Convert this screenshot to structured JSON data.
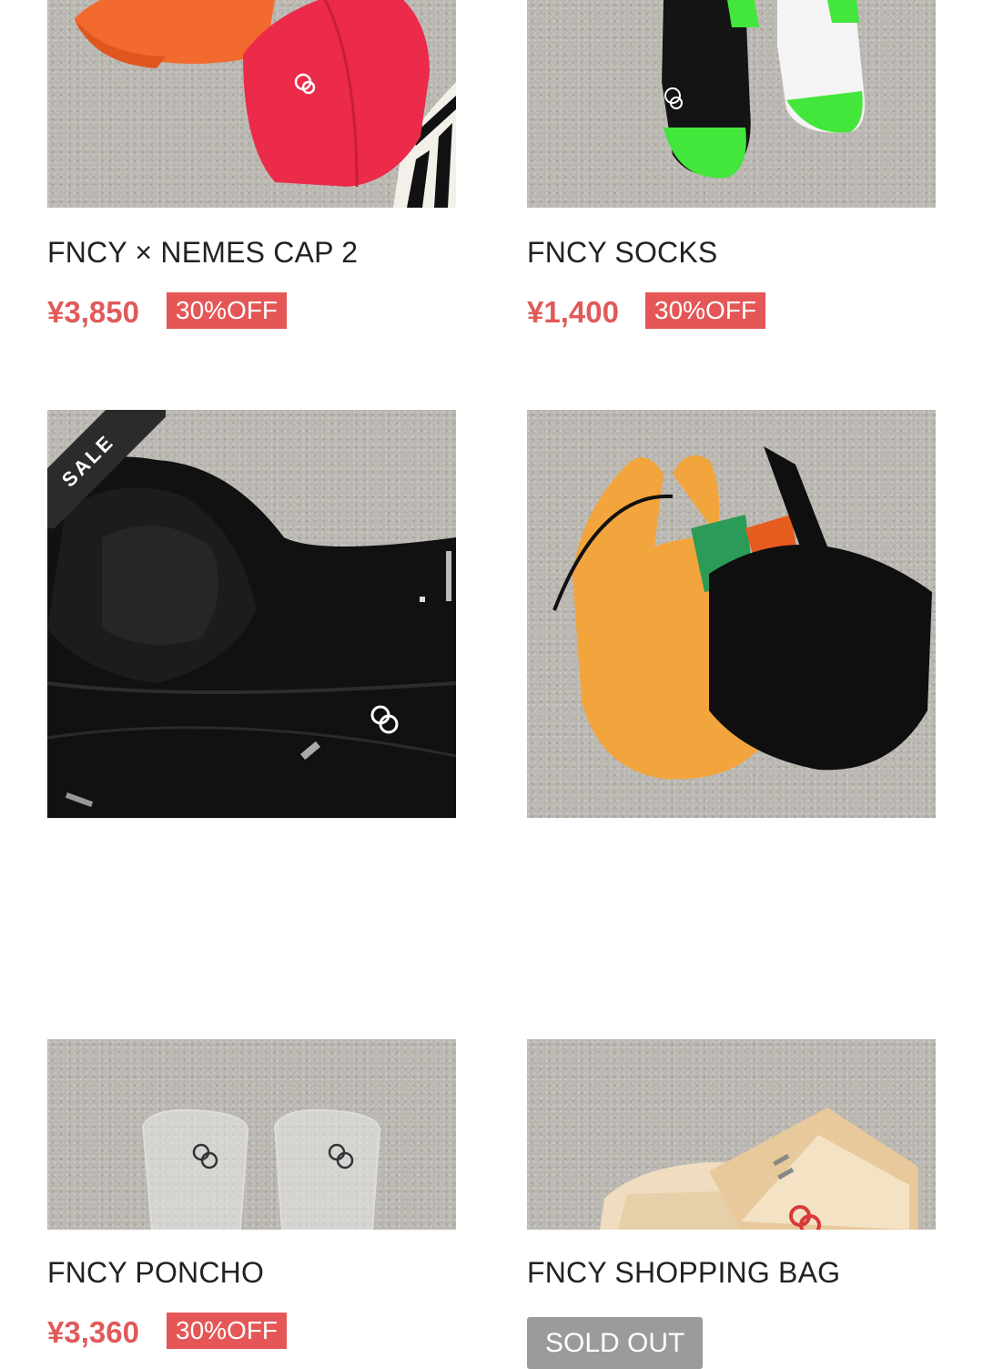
{
  "products": [
    {
      "name": "FNCY × NEMES CAP 2",
      "price": "¥3,850",
      "discount": "30%OFF"
    },
    {
      "name": "FNCY SOCKS",
      "price": "¥1,400",
      "discount": "30%OFF"
    },
    {
      "name": "FNCY PONCHO",
      "price": "¥3,360",
      "discount": "30%OFF",
      "ribbon": "SALE"
    },
    {
      "name": "FNCY SHOPPING BAG",
      "status": "SOLD OUT"
    }
  ],
  "colors": {
    "price": "#e05a5a",
    "discount_badge": "#e55656",
    "sold_out_badge": "#9b9b9b",
    "sale_ribbon": "#2b2b2b"
  },
  "icons": [
    "fncy-logo-icon"
  ]
}
